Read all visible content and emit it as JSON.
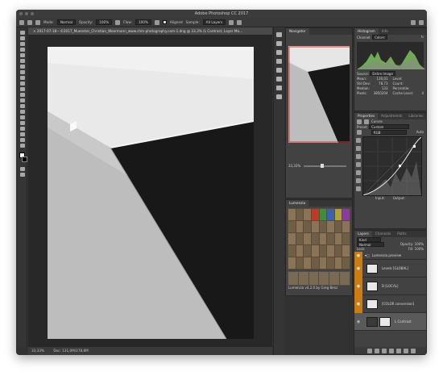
{
  "app": {
    "title": "Adobe Photoshop CC 2017"
  },
  "options_bar": {
    "mode_label": "Mode:",
    "mode_value": "Normal",
    "opacity_label": "Opacity:",
    "opacity_value": "100%",
    "flow_label": "Flow:",
    "flow_value": "100%",
    "aligned_label": "Aligned",
    "sample_label": "Sample:",
    "sample_value": "All Layers"
  },
  "document": {
    "tab_title": "× 2017-07-18---©2017_Muenster_Christian_Woermann_www.chm-photography.com-1.dng @ 33,3% (L Contrast, Layer Ma...",
    "status_zoom": "33,33%",
    "status_doc": "Doc: 131,0M/278,8M"
  },
  "navigator": {
    "tabs": [
      "Navigator"
    ],
    "zoom": "33,33%"
  },
  "histogram": {
    "tabs": [
      "Histogram",
      "Info"
    ],
    "channel_label": "Channel:",
    "channel_value": "Colors",
    "source_label": "Source:",
    "source_value": "Entire Image",
    "stats_left": [
      {
        "label": "Mean:",
        "value": "130,01"
      },
      {
        "label": "Std Dev:",
        "value": "78,73"
      },
      {
        "label": "Median:",
        "value": "133"
      },
      {
        "label": "Pixels:",
        "value": "3850204"
      }
    ],
    "stats_right": [
      {
        "label": "Level:",
        "value": ""
      },
      {
        "label": "Count:",
        "value": ""
      },
      {
        "label": "Percentile:",
        "value": ""
      },
      {
        "label": "Cache Level:",
        "value": "4"
      }
    ]
  },
  "properties": {
    "tabs": [
      "Properties",
      "Adjustments",
      "Libraries"
    ],
    "title": "Curves",
    "preset_label": "Preset:",
    "preset_value": "Custom",
    "channel_value": "RGB",
    "auto_label": "Auto",
    "input_label": "Input:",
    "output_label": "Output:"
  },
  "luminosity": {
    "title": "Lumenzia",
    "rows": [
      "Basic",
      "Normal",
      "Sat",
      "Zone",
      "Curve"
    ],
    "footer": "Lumenzia v4.2.0 by Greg Benz"
  },
  "layers": {
    "tabs": [
      "Layers",
      "Channels",
      "Paths"
    ],
    "kind_label": "Kind",
    "blend_value": "Normal",
    "opacity_label": "Opacity:",
    "opacity_value": "100%",
    "lock_label": "Lock:",
    "fill_label": "Fill:",
    "fill_value": "100%",
    "items": [
      {
        "name": "Lumenzia preview",
        "type": "group"
      },
      {
        "name": "Levels [GLOBAL]",
        "type": "adjustment"
      },
      {
        "name": "D [LOCAL]",
        "type": "adjustment"
      },
      {
        "name": "[COLOR conversion]",
        "type": "adjustment"
      },
      {
        "name": "L Contrast",
        "type": "curves"
      }
    ]
  },
  "colors": {
    "accent": "#c97d12",
    "panel": "#424242",
    "bg": "#323232"
  }
}
